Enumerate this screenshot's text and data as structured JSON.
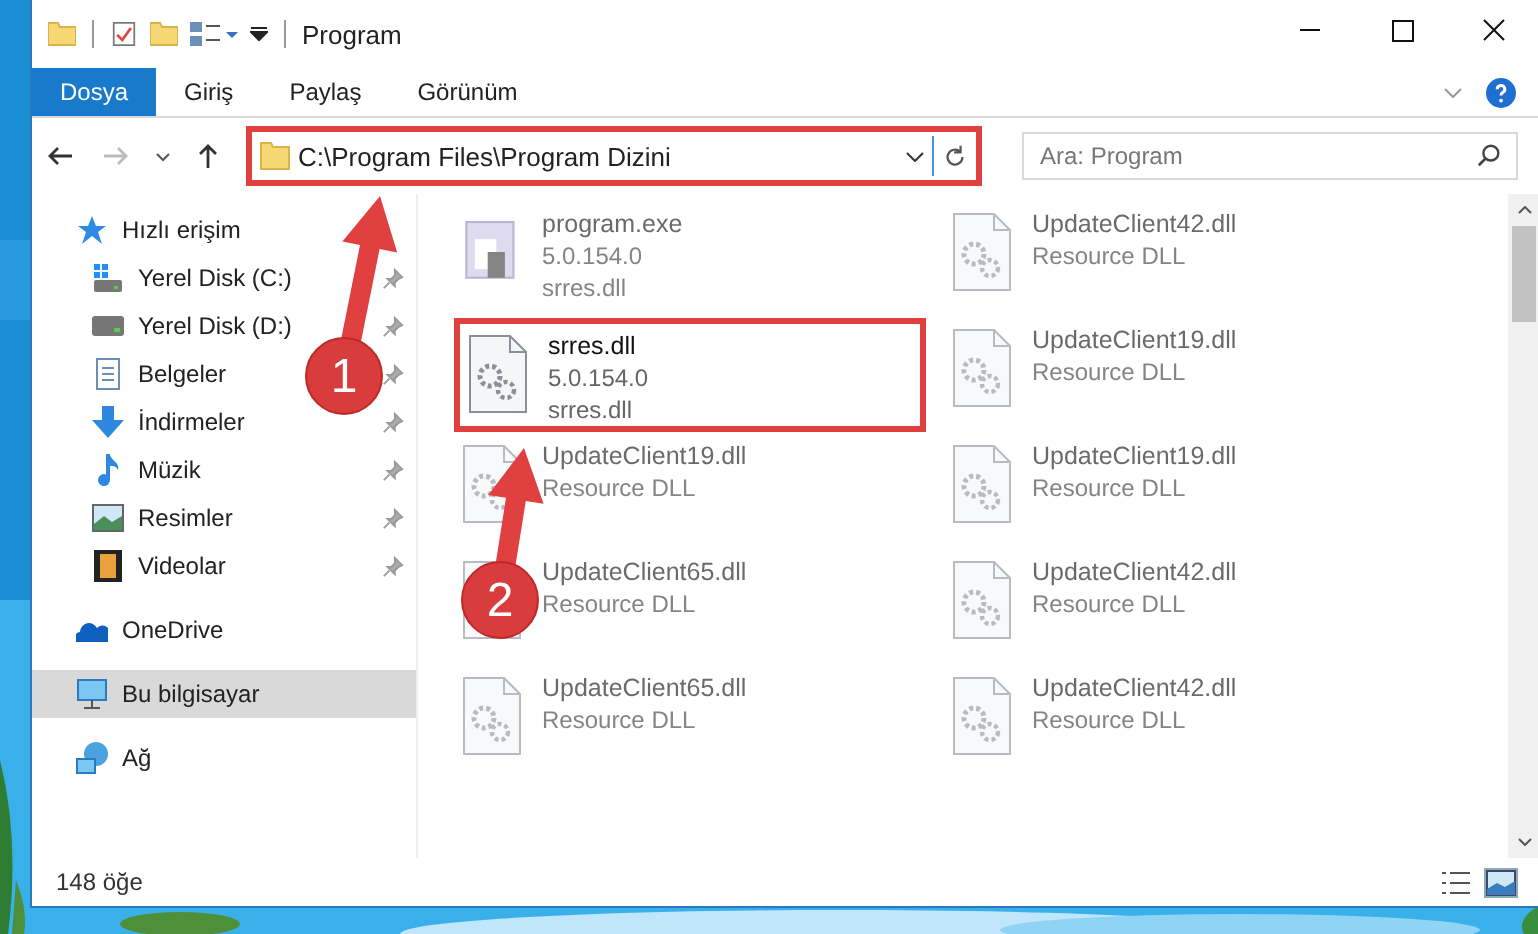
{
  "window": {
    "title": "Program"
  },
  "ribbon_tabs": [
    {
      "label": "Dosya",
      "selected": true
    },
    {
      "label": "Giriş",
      "selected": false
    },
    {
      "label": "Paylaş",
      "selected": false
    },
    {
      "label": "Görünüm",
      "selected": false
    }
  ],
  "address_bar": {
    "path": "C:\\Program Files\\Program Dizini",
    "highlighted": true
  },
  "search": {
    "placeholder": "Ara: Program"
  },
  "sidebar": {
    "items": [
      {
        "label": "Hızlı erişim",
        "kind": "star",
        "selected": false,
        "children": [
          {
            "label": "Yerel Disk (C:)",
            "kind": "windrive",
            "pinned": true,
            "selected": false
          },
          {
            "label": "Yerel Disk (D:)",
            "kind": "drive",
            "pinned": true,
            "selected": false
          },
          {
            "label": "Belgeler",
            "kind": "document",
            "pinned": true,
            "selected": false
          },
          {
            "label": "İndirmeler",
            "kind": "download",
            "pinned": true,
            "selected": false
          },
          {
            "label": "Müzik",
            "kind": "music",
            "pinned": true,
            "selected": false
          },
          {
            "label": "Resimler",
            "kind": "pictures",
            "pinned": true,
            "selected": false
          },
          {
            "label": "Videolar",
            "kind": "videos",
            "pinned": true,
            "selected": false
          }
        ]
      },
      {
        "label": "OneDrive",
        "kind": "cloud",
        "selected": false
      },
      {
        "label": "Bu bilgisayar",
        "kind": "computer",
        "selected": true
      },
      {
        "label": "Ağ",
        "kind": "network",
        "selected": false
      }
    ]
  },
  "files": [
    {
      "name": "program.exe",
      "lines": [
        "5.0.154.0",
        "srres.dll"
      ],
      "kind": "program",
      "blurred": true,
      "highlighted": false
    },
    {
      "name": "UpdateClient42.dll",
      "lines": [
        "Resource DLL"
      ],
      "kind": "library",
      "blurred": true,
      "highlighted": false
    },
    {
      "name": "srres.dll",
      "lines": [
        "5.0.154.0",
        "srres.dll"
      ],
      "kind": "library",
      "blurred": false,
      "highlighted": true
    },
    {
      "name": "UpdateClient19.dll",
      "lines": [
        "Resource DLL"
      ],
      "kind": "library",
      "blurred": true,
      "highlighted": false
    },
    {
      "name": "UpdateClient19.dll",
      "lines": [
        "Resource DLL"
      ],
      "kind": "library",
      "blurred": true,
      "highlighted": false
    },
    {
      "name": "UpdateClient19.dll",
      "lines": [
        "Resource DLL"
      ],
      "kind": "library",
      "blurred": true,
      "highlighted": false
    },
    {
      "name": "UpdateClient65.dll",
      "lines": [
        "Resource DLL"
      ],
      "kind": "library",
      "blurred": true,
      "highlighted": false
    },
    {
      "name": "UpdateClient42.dll",
      "lines": [
        "Resource DLL"
      ],
      "kind": "library",
      "blurred": true,
      "highlighted": false
    },
    {
      "name": "UpdateClient65.dll",
      "lines": [
        "Resource DLL"
      ],
      "kind": "library",
      "blurred": true,
      "highlighted": false
    },
    {
      "name": "UpdateClient42.dll",
      "lines": [
        "Resource DLL"
      ],
      "kind": "library",
      "blurred": true,
      "highlighted": false
    }
  ],
  "status_bar": {
    "count": "148 öğe"
  },
  "annotations": [
    {
      "number": "1"
    },
    {
      "number": "2"
    }
  ]
}
